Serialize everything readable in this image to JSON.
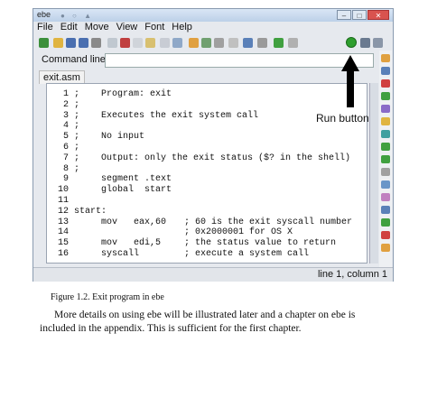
{
  "window": {
    "title": "ebe",
    "menu": [
      "File",
      "Edit",
      "Move",
      "View",
      "Font",
      "Help"
    ],
    "command_label": "Command line",
    "command_value": "",
    "tab": "exit.asm",
    "status": "line 1, column 1"
  },
  "code_lines": [
    {
      "n": "1",
      "code": ";    Program: exit",
      "comment": ""
    },
    {
      "n": "2",
      "code": ";",
      "comment": ""
    },
    {
      "n": "3",
      "code": ";    Executes the exit system call",
      "comment": ""
    },
    {
      "n": "4",
      "code": ";",
      "comment": ""
    },
    {
      "n": "5",
      "code": ";    No input",
      "comment": ""
    },
    {
      "n": "6",
      "code": ";",
      "comment": ""
    },
    {
      "n": "7",
      "code": ";    Output: only the exit status ($? in the shell)",
      "comment": ""
    },
    {
      "n": "8",
      "code": ";",
      "comment": ""
    },
    {
      "n": "9",
      "code": "     segment .text",
      "comment": ""
    },
    {
      "n": "10",
      "code": "     global  start",
      "comment": ""
    },
    {
      "n": "11",
      "code": "",
      "comment": ""
    },
    {
      "n": "12",
      "code": "start:",
      "comment": ""
    },
    {
      "n": "13",
      "code": "     mov   eax,60",
      "comment": "; 60 is the exit syscall number"
    },
    {
      "n": "14",
      "code": "",
      "comment": "; 0x2000001 for OS X"
    },
    {
      "n": "15",
      "code": "     mov   edi,5",
      "comment": "; the status value to return"
    },
    {
      "n": "16",
      "code": "     syscall",
      "comment": "; execute a system call"
    }
  ],
  "annotation": "Run button",
  "caption": "Figure 1.2.  Exit program in ebe",
  "paragraph": "More details on using ebe will be illustrated later and a chapter on ebe is included in the appendix. This is sufficient for the first chapter.",
  "colors": {
    "run": "#2e9e2e",
    "editor_bg": "#ffffff",
    "window_bg": "#e6e9ee"
  }
}
